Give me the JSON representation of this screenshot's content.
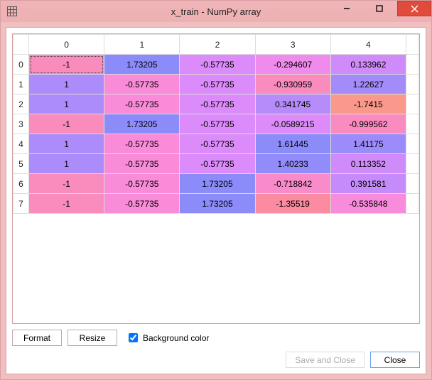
{
  "window": {
    "title": "x_train - NumPy array"
  },
  "chart_data": {
    "type": "table",
    "title": "x_train - NumPy array",
    "col_headers": [
      "0",
      "1",
      "2",
      "3",
      "4"
    ],
    "row_headers": [
      "0",
      "1",
      "2",
      "3",
      "4",
      "5",
      "6",
      "7"
    ],
    "cells": [
      [
        {
          "v": "-1",
          "c": "#fa8bbd"
        },
        {
          "v": "1.73205",
          "c": "#8b8bfa"
        },
        {
          "v": "-0.57735",
          "c": "#db8bfa"
        },
        {
          "v": "-0.294607",
          "c": "#ee8bed"
        },
        {
          "v": "0.133962",
          "c": "#d08bfa"
        }
      ],
      [
        {
          "v": "1",
          "c": "#ac8bfa"
        },
        {
          "v": "-0.57735",
          "c": "#fa8bd8"
        },
        {
          "v": "-0.57735",
          "c": "#db8bfa"
        },
        {
          "v": "-0.930959",
          "c": "#fa8bbd"
        },
        {
          "v": "1.22627",
          "c": "#a48bfa"
        }
      ],
      [
        {
          "v": "1",
          "c": "#ac8bfa"
        },
        {
          "v": "-0.57735",
          "c": "#fa8bd8"
        },
        {
          "v": "-0.57735",
          "c": "#db8bfa"
        },
        {
          "v": "0.341745",
          "c": "#b68bfa"
        },
        {
          "v": "-1.7415",
          "c": "#fa988b"
        }
      ],
      [
        {
          "v": "-1",
          "c": "#fa8bbd"
        },
        {
          "v": "1.73205",
          "c": "#8b8bfa"
        },
        {
          "v": "-0.57735",
          "c": "#db8bfa"
        },
        {
          "v": "-0.0589215",
          "c": "#de8bfa"
        },
        {
          "v": "-0.999562",
          "c": "#fa8bc0"
        }
      ],
      [
        {
          "v": "1",
          "c": "#ac8bfa"
        },
        {
          "v": "-0.57735",
          "c": "#fa8bd8"
        },
        {
          "v": "-0.57735",
          "c": "#db8bfa"
        },
        {
          "v": "1.61445",
          "c": "#8b8bfa"
        },
        {
          "v": "1.41175",
          "c": "#9c8bfa"
        }
      ],
      [
        {
          "v": "1",
          "c": "#ac8bfa"
        },
        {
          "v": "-0.57735",
          "c": "#fa8bd8"
        },
        {
          "v": "-0.57735",
          "c": "#db8bfa"
        },
        {
          "v": "1.40233",
          "c": "#928bfa"
        },
        {
          "v": "0.113352",
          "c": "#d08bfa"
        }
      ],
      [
        {
          "v": "-1",
          "c": "#fa8bbd"
        },
        {
          "v": "-0.57735",
          "c": "#fa8bd8"
        },
        {
          "v": "1.73205",
          "c": "#8b8bfa"
        },
        {
          "v": "-0.718842",
          "c": "#fa8bca"
        },
        {
          "v": "0.391581",
          "c": "#c58bfa"
        }
      ],
      [
        {
          "v": "-1",
          "c": "#fa8bbd"
        },
        {
          "v": "-0.57735",
          "c": "#fa8bd8"
        },
        {
          "v": "1.73205",
          "c": "#8b8bfa"
        },
        {
          "v": "-1.35519",
          "c": "#fa8ba1"
        },
        {
          "v": "-0.535848",
          "c": "#f98bdc"
        }
      ]
    ]
  },
  "controls": {
    "format_label": "Format",
    "resize_label": "Resize",
    "bgcolor_label": "Background color",
    "bgcolor_checked": true
  },
  "dialog": {
    "save_close_label": "Save and Close",
    "close_label": "Close"
  }
}
